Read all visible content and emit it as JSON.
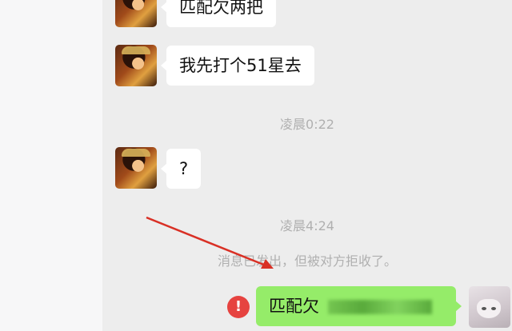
{
  "messages": {
    "m1": {
      "text": "匹配欠两把"
    },
    "m2": {
      "text": "我先打个51星去"
    },
    "ts1": "凌晨0:22",
    "m3": {
      "text": "?"
    },
    "ts2": "凌晨4:24",
    "system_note": "消息已发出，但被对方拒收了。",
    "m4": {
      "text": "匹配欠"
    }
  },
  "icons": {
    "error": "!",
    "error_color": "#e64340"
  },
  "colors": {
    "sent_bubble": "#95ec69",
    "received_bubble": "#ffffff",
    "chat_bg": "#ededed",
    "annotation_arrow": "#d93025"
  }
}
